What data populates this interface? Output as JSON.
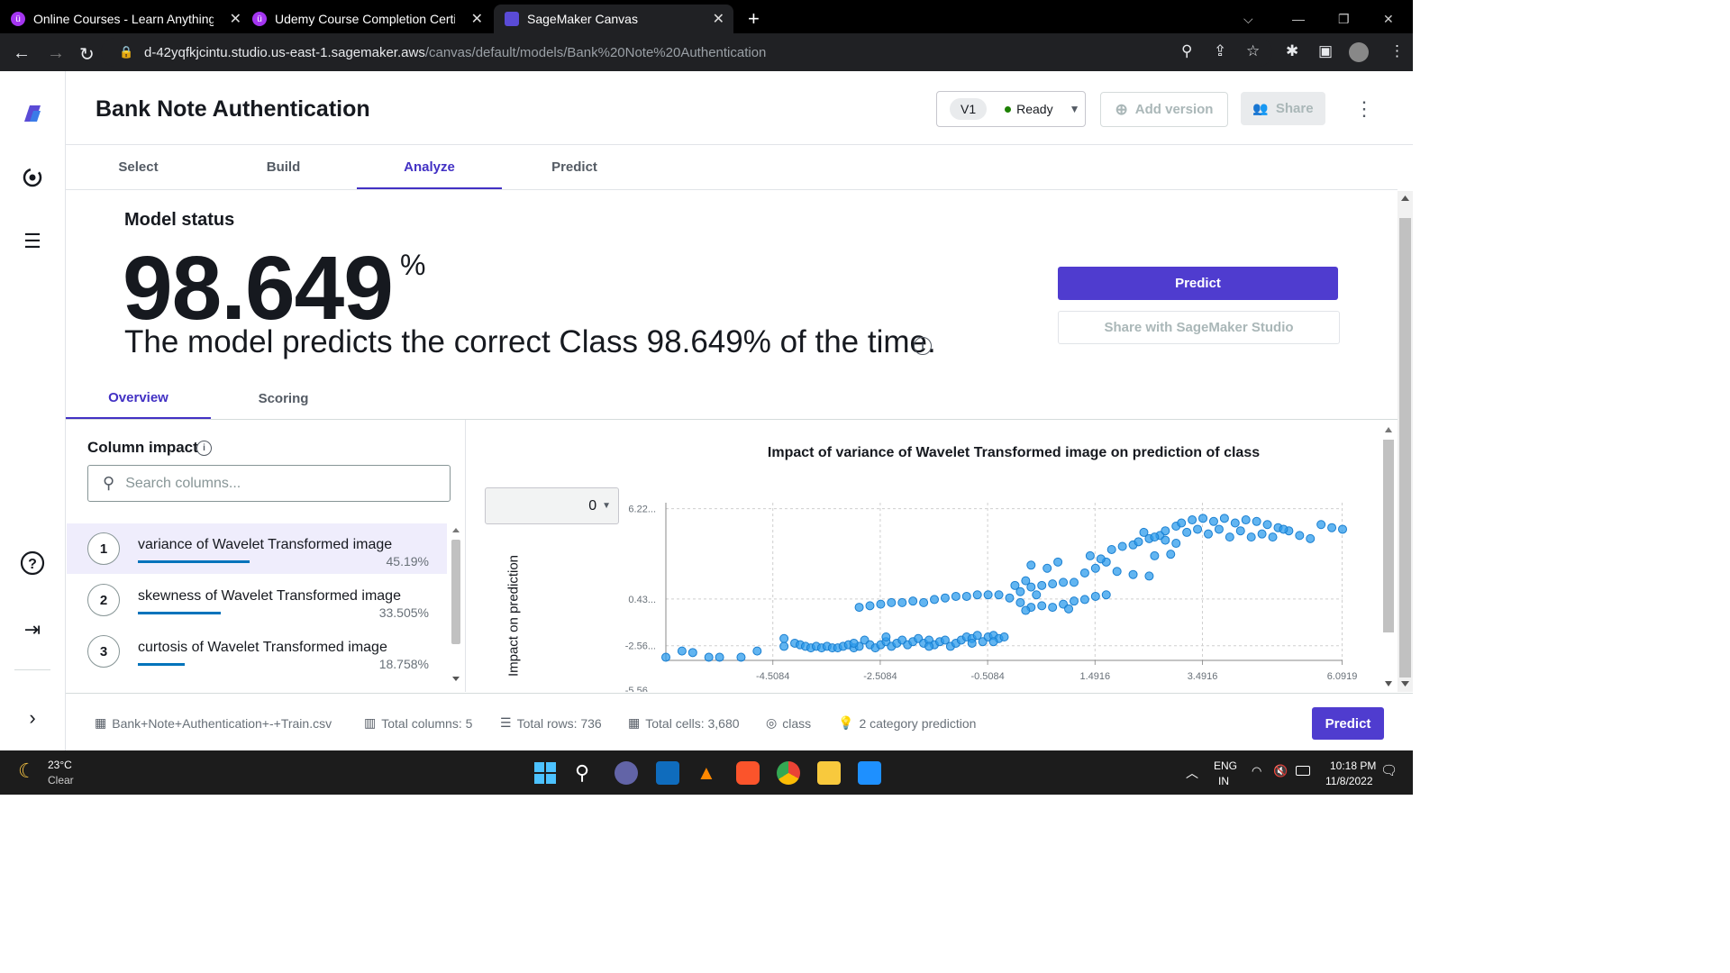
{
  "browser": {
    "tabs": [
      {
        "title": "Online Courses - Learn Anything,",
        "active": false
      },
      {
        "title": "Udemy Course Completion Certif",
        "active": false
      },
      {
        "title": "SageMaker Canvas",
        "active": true
      }
    ],
    "new_tab": "+",
    "url_host": "d-42yqfkjcintu.studio.us-east-1.sagemaker.aws",
    "url_path": "/canvas/default/models/Bank%20Note%20Authentication"
  },
  "header": {
    "title": "Bank Note Authentication",
    "version_badge": "V1",
    "version_status": "Ready",
    "add_version": "Add version",
    "share": "Share"
  },
  "steps": [
    {
      "label": "Select",
      "active": false
    },
    {
      "label": "Build",
      "active": false
    },
    {
      "label": "Analyze",
      "active": true
    },
    {
      "label": "Predict",
      "active": false
    }
  ],
  "model_status": {
    "heading": "Model status",
    "accuracy": "98.649",
    "percent_sign": "%",
    "sentence": "The model predicts the correct Class 98.649% of the time.",
    "predict_button": "Predict",
    "share_studio_button": "Share with SageMaker Studio"
  },
  "subtabs": [
    {
      "label": "Overview",
      "active": true
    },
    {
      "label": "Scoring",
      "active": false
    }
  ],
  "column_impact": {
    "heading": "Column impact",
    "search_placeholder": "Search columns...",
    "items": [
      {
        "rank": "1",
        "name": "variance of Wavelet Transformed image",
        "percent": "45.19%",
        "value": 45.19
      },
      {
        "rank": "2",
        "name": "skewness of Wavelet Transformed image",
        "percent": "33.505%",
        "value": 33.505
      },
      {
        "rank": "3",
        "name": "curtosis of Wavelet Transformed image",
        "percent": "18.758%",
        "value": 18.758
      }
    ]
  },
  "chart_data": {
    "type": "scatter",
    "title": "Impact of variance of Wavelet Transformed image on prediction of class",
    "class_select_value": "0",
    "ylabel": "Impact on prediction",
    "xlabel": "",
    "x_ticks": [
      "-4.5084",
      "-2.5084",
      "-0.5084",
      "1.4916",
      "3.4916",
      "6.0919"
    ],
    "x_tick_values": [
      -4.5084,
      -2.5084,
      -0.5084,
      1.4916,
      3.4916,
      6.0919
    ],
    "y_ticks": [
      "6.22...",
      "0.43...",
      "-2.56...",
      "-5.56..."
    ],
    "y_tick_values": [
      6.22,
      0.43,
      -2.56,
      -5.56
    ],
    "xlim": [
      -6.5,
      6.1
    ],
    "ylim": [
      -3.5,
      6.6
    ],
    "grid": true,
    "point_color": "#2e9cec",
    "points": [
      [
        -6.5,
        -3.3
      ],
      [
        -6.2,
        -2.9
      ],
      [
        -6.0,
        -3.0
      ],
      [
        -5.7,
        -3.3
      ],
      [
        -5.5,
        -3.3
      ],
      [
        -5.1,
        -3.3
      ],
      [
        -4.8,
        -2.9
      ],
      [
        -4.3,
        -2.6
      ],
      [
        -4.3,
        -2.1
      ],
      [
        -4.1,
        -2.4
      ],
      [
        -4.0,
        -2.5
      ],
      [
        -3.9,
        -2.6
      ],
      [
        -3.8,
        -2.7
      ],
      [
        -3.7,
        -2.6
      ],
      [
        -3.6,
        -2.7
      ],
      [
        -3.5,
        -2.6
      ],
      [
        -3.4,
        -2.7
      ],
      [
        -3.3,
        -2.7
      ],
      [
        -3.2,
        -2.6
      ],
      [
        -3.1,
        -2.5
      ],
      [
        -3.0,
        -2.7
      ],
      [
        -2.9,
        -2.6
      ],
      [
        -2.8,
        -2.2
      ],
      [
        -2.7,
        -2.5
      ],
      [
        -2.6,
        -2.7
      ],
      [
        -2.5,
        -2.5
      ],
      [
        -2.4,
        -2.3
      ],
      [
        -2.3,
        -2.6
      ],
      [
        -2.2,
        -2.4
      ],
      [
        -2.1,
        -2.2
      ],
      [
        -2.0,
        -2.5
      ],
      [
        -1.9,
        -2.3
      ],
      [
        -1.8,
        -2.1
      ],
      [
        -1.7,
        -2.4
      ],
      [
        -1.6,
        -2.2
      ],
      [
        -1.5,
        -2.5
      ],
      [
        -1.4,
        -2.3
      ],
      [
        -1.3,
        -2.2
      ],
      [
        -1.2,
        -2.6
      ],
      [
        -1.1,
        -2.4
      ],
      [
        -1.0,
        -2.2
      ],
      [
        -0.9,
        -2.0
      ],
      [
        -0.8,
        -2.1
      ],
      [
        -0.7,
        -1.9
      ],
      [
        -0.6,
        -2.3
      ],
      [
        -0.5,
        -2.0
      ],
      [
        -0.4,
        -1.9
      ],
      [
        -0.3,
        -2.1
      ],
      [
        -0.2,
        -2.0
      ],
      [
        -2.9,
        -0.1
      ],
      [
        -2.7,
        0.0
      ],
      [
        -2.5,
        0.1
      ],
      [
        -2.3,
        0.2
      ],
      [
        -2.1,
        0.2
      ],
      [
        -1.9,
        0.3
      ],
      [
        -1.7,
        0.2
      ],
      [
        -1.5,
        0.4
      ],
      [
        -1.3,
        0.5
      ],
      [
        -1.1,
        0.6
      ],
      [
        -0.9,
        0.6
      ],
      [
        -0.7,
        0.7
      ],
      [
        -0.5,
        0.7
      ],
      [
        -0.3,
        0.7
      ],
      [
        -0.1,
        0.5
      ],
      [
        0.1,
        0.2
      ],
      [
        0.3,
        -0.1
      ],
      [
        0.5,
        0.0
      ],
      [
        0.7,
        -0.1
      ],
      [
        0.9,
        0.1
      ],
      [
        1.1,
        0.3
      ],
      [
        1.3,
        0.4
      ],
      [
        1.5,
        0.6
      ],
      [
        1.7,
        0.7
      ],
      [
        0.0,
        1.3
      ],
      [
        0.2,
        1.6
      ],
      [
        0.3,
        1.2
      ],
      [
        0.5,
        1.3
      ],
      [
        0.7,
        1.4
      ],
      [
        0.9,
        1.5
      ],
      [
        1.1,
        1.5
      ],
      [
        0.3,
        2.6
      ],
      [
        0.6,
        2.4
      ],
      [
        0.8,
        2.8
      ],
      [
        1.3,
        2.1
      ],
      [
        1.5,
        2.4
      ],
      [
        1.7,
        2.8
      ],
      [
        1.4,
        3.2
      ],
      [
        1.6,
        3.0
      ],
      [
        1.8,
        3.6
      ],
      [
        2.0,
        3.8
      ],
      [
        2.2,
        3.9
      ],
      [
        2.3,
        4.1
      ],
      [
        2.5,
        4.3
      ],
      [
        2.7,
        4.5
      ],
      [
        2.8,
        4.8
      ],
      [
        3.0,
        5.1
      ],
      [
        3.1,
        5.3
      ],
      [
        3.3,
        5.5
      ],
      [
        3.5,
        5.6
      ],
      [
        3.7,
        5.4
      ],
      [
        3.9,
        5.6
      ],
      [
        4.1,
        5.3
      ],
      [
        4.3,
        5.5
      ],
      [
        4.5,
        5.4
      ],
      [
        4.7,
        5.2
      ],
      [
        4.9,
        5.0
      ],
      [
        5.1,
        4.8
      ],
      [
        5.3,
        4.5
      ],
      [
        5.5,
        4.3
      ],
      [
        5.7,
        5.2
      ],
      [
        5.9,
        5.0
      ],
      [
        6.1,
        4.9
      ],
      [
        2.2,
        2.0
      ],
      [
        2.5,
        1.9
      ],
      [
        1.9,
        2.2
      ],
      [
        2.6,
        3.2
      ],
      [
        2.9,
        3.3
      ],
      [
        3.2,
        4.7
      ],
      [
        3.4,
        4.9
      ],
      [
        3.8,
        4.9
      ],
      [
        4.0,
        4.4
      ],
      [
        4.4,
        4.4
      ],
      [
        4.6,
        4.6
      ],
      [
        4.8,
        4.4
      ],
      [
        5.0,
        4.9
      ],
      [
        0.1,
        0.9
      ],
      [
        0.4,
        0.7
      ],
      [
        -0.8,
        -2.4
      ],
      [
        -2.4,
        -2.0
      ],
      [
        -3.0,
        -2.4
      ],
      [
        -1.6,
        -2.6
      ],
      [
        -0.4,
        -2.3
      ],
      [
        0.2,
        -0.3
      ],
      [
        1.0,
        -0.2
      ],
      [
        2.8,
        4.2
      ],
      [
        3.6,
        4.6
      ],
      [
        4.2,
        4.8
      ],
      [
        3.0,
        4.0
      ],
      [
        2.4,
        4.7
      ],
      [
        2.6,
        4.4
      ]
    ]
  },
  "footer": {
    "dataset": "Bank+Note+Authentication+-+Train.csv",
    "total_columns": "Total columns: 5",
    "total_rows": "Total rows: 736",
    "total_cells": "Total cells: 3,680",
    "target": "class",
    "prediction_type": "2 category prediction",
    "predict_button": "Predict"
  },
  "taskbar": {
    "temperature": "23°C",
    "weather": "Clear",
    "lang_top": "ENG",
    "lang_bottom": "IN",
    "time": "10:18 PM",
    "date": "11/8/2022"
  }
}
